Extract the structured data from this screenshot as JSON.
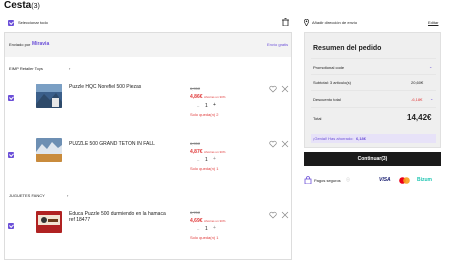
{
  "page_title": "Cesta",
  "item_count_label": "(3)",
  "select_all_label": "Seleccionar todo",
  "address_label": "Añadir dirección de envío",
  "edit_label": "Editar",
  "shipped_by_label": "Enviado por",
  "shipped_by_brand": "Miravia",
  "free_shipping_label": "Envío gratis",
  "stores": [
    {
      "name": "EIMP Retailer Toys",
      "items": [
        {
          "title": "Puzzle HQC Norefiel 500 Piezas",
          "original_price": "6,95€",
          "price": "4,86€",
          "discount_note": "Ahorras un 30%",
          "qty": "1",
          "stock_note": "Solo queda(n) 2"
        },
        {
          "title": "PUZZLE 500 GRAND TETON IN FALL",
          "original_price": "6,95€",
          "price": "4,87€",
          "discount_note": "Ahorras un 30%",
          "qty": "1",
          "stock_note": "Solo queda(n) 1"
        }
      ]
    },
    {
      "name": "JUGUETES FANCY",
      "items": [
        {
          "title": "Educa Puzzle 500 durmiendo en la hamaca ref 18477",
          "original_price": "6,70€",
          "price": "4,69€",
          "discount_note": "Ahorras un 30%",
          "qty": "1",
          "stock_note": "Solo queda(n) 1"
        }
      ]
    }
  ],
  "summary": {
    "title": "Resumen del pedido",
    "promo_label": "Promotional code",
    "subtotal_label": "Subtotal: 3 artículo(s)",
    "subtotal_value": "20,60€",
    "discount_label": "Descuento total",
    "discount_value": "-6,18€",
    "total_label": "Total",
    "total_value": "14,42€",
    "savings_label": "¡Genial! Has ahorrado:",
    "savings_value": "6,18€",
    "checkout_label": "Continuar(3)"
  },
  "payment": {
    "secure_label": "Pagos seguros",
    "methods": [
      "VISA",
      "mastercard",
      "Bizum"
    ]
  },
  "colors": {
    "accent": "#6b4fd8",
    "sale": "#e03a3a",
    "dark": "#1a1a1a"
  }
}
